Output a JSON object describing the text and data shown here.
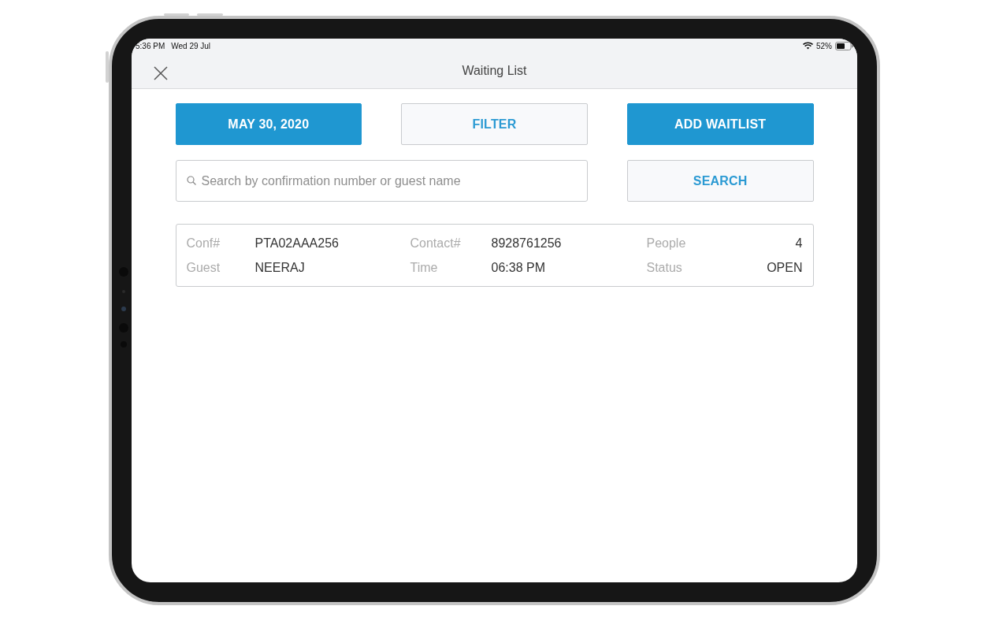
{
  "status_bar": {
    "time": "5:36 PM",
    "date": "Wed 29 Jul",
    "battery": "52%"
  },
  "header": {
    "title": "Waiting List"
  },
  "actions": [
    {
      "kind": "primary",
      "label": "MAY 30, 2020"
    },
    {
      "kind": "secondary",
      "label": "FILTER"
    },
    {
      "kind": "primary",
      "label": "ADD WAITLIST"
    }
  ],
  "search": {
    "placeholder": "Search by confirmation number or guest name",
    "button": "SEARCH"
  },
  "entries": [
    {
      "fields": [
        {
          "label": "Conf#",
          "value": "PTA02AAA256"
        },
        {
          "label": "Contact#",
          "value": "8928761256"
        },
        {
          "label": "People",
          "value": "4"
        },
        {
          "label": "Guest",
          "value": "NEERAJ"
        },
        {
          "label": "Time",
          "value": "06:38 PM"
        },
        {
          "label": "Status",
          "value": "OPEN"
        }
      ]
    }
  ]
}
